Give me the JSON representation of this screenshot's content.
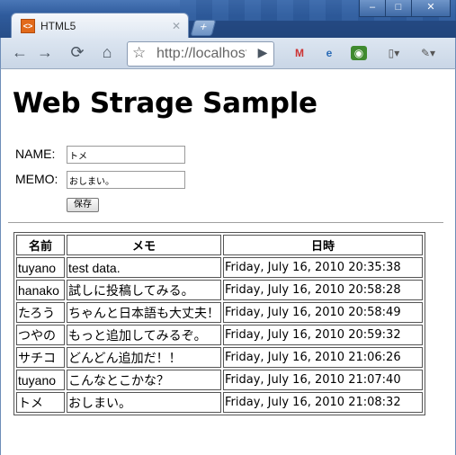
{
  "window": {
    "tab_title": "HTML5",
    "url": "http://localhost",
    "controls": [
      "–",
      "□",
      "✕"
    ]
  },
  "page": {
    "heading": "Web Strage Sample",
    "name_label": "NAME:",
    "name_value": "トメ",
    "memo_label": "MEMO:",
    "memo_value": "おしまい。",
    "save_label": "保存"
  },
  "table": {
    "headers": [
      "名前",
      "メモ",
      "日時"
    ],
    "rows": [
      [
        "tuyano",
        "test data.",
        "Friday, July 16, 2010 20:35:38"
      ],
      [
        "hanako",
        "試しに投稿してみる。",
        "Friday, July 16, 2010 20:58:28"
      ],
      [
        "たろう",
        "ちゃんと日本語も大丈夫！",
        "Friday, July 16, 2010 20:58:49"
      ],
      [
        "つやの",
        "もっと追加してみるぞ。",
        "Friday, July 16, 2010 20:59:32"
      ],
      [
        "サチコ",
        "どんどん追加だ！！",
        "Friday, July 16, 2010 21:06:26"
      ],
      [
        "tuyano",
        "こんなとこかな？",
        "Friday, July 16, 2010 21:07:40"
      ],
      [
        "トメ",
        "おしまい。",
        "Friday, July 16, 2010 21:08:32"
      ]
    ]
  }
}
